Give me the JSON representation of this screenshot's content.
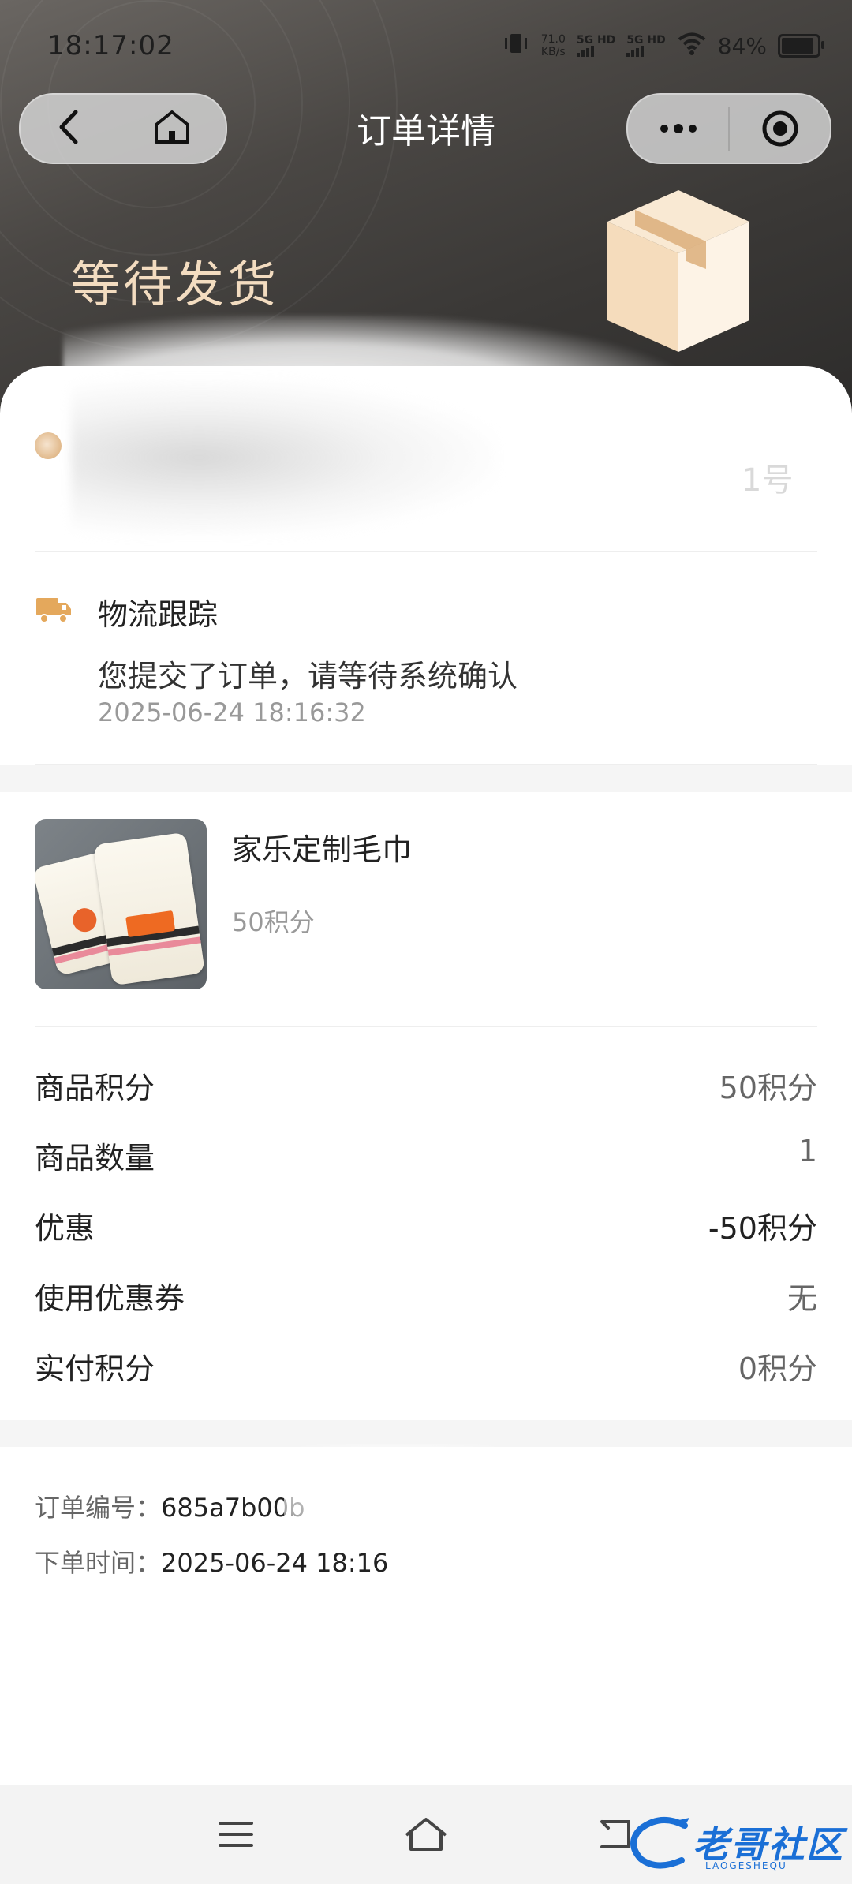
{
  "status_bar": {
    "time": "18:17:02",
    "speed_value": "71.0",
    "speed_unit": "KB/s",
    "sim1": "5G HD",
    "sim2": "5G HD",
    "battery": "84%",
    "battery_level": 0.84
  },
  "nav": {
    "title": "订单详情"
  },
  "order": {
    "status": "等待发货"
  },
  "address": {
    "visible_text": "1号"
  },
  "logistics": {
    "title": "物流跟踪",
    "message": "您提交了订单，请等待系统确认",
    "time": "2025-06-24 18:16:32"
  },
  "product": {
    "name": "家乐定制毛巾",
    "price": "50积分"
  },
  "summary": {
    "rows": [
      {
        "label": "商品积分",
        "value": "50积分"
      },
      {
        "label": "商品数量",
        "value": "1"
      },
      {
        "label": "优惠",
        "value": "-50积分"
      },
      {
        "label": "使用优惠券",
        "value": "无"
      },
      {
        "label": "实付积分",
        "value": "0积分"
      }
    ]
  },
  "info": {
    "order_no_label": "订单编号：",
    "order_no_value": "685a7b00b",
    "order_time_label": "下单时间：",
    "order_time_value": "2025-06-24 18:16"
  },
  "watermark": {
    "text": "老哥社区",
    "sub": "LAOGESHEQU"
  },
  "colors": {
    "accent": "#e4a85c",
    "status_text": "#f3dcc0",
    "header_dark": "#3a3836"
  }
}
